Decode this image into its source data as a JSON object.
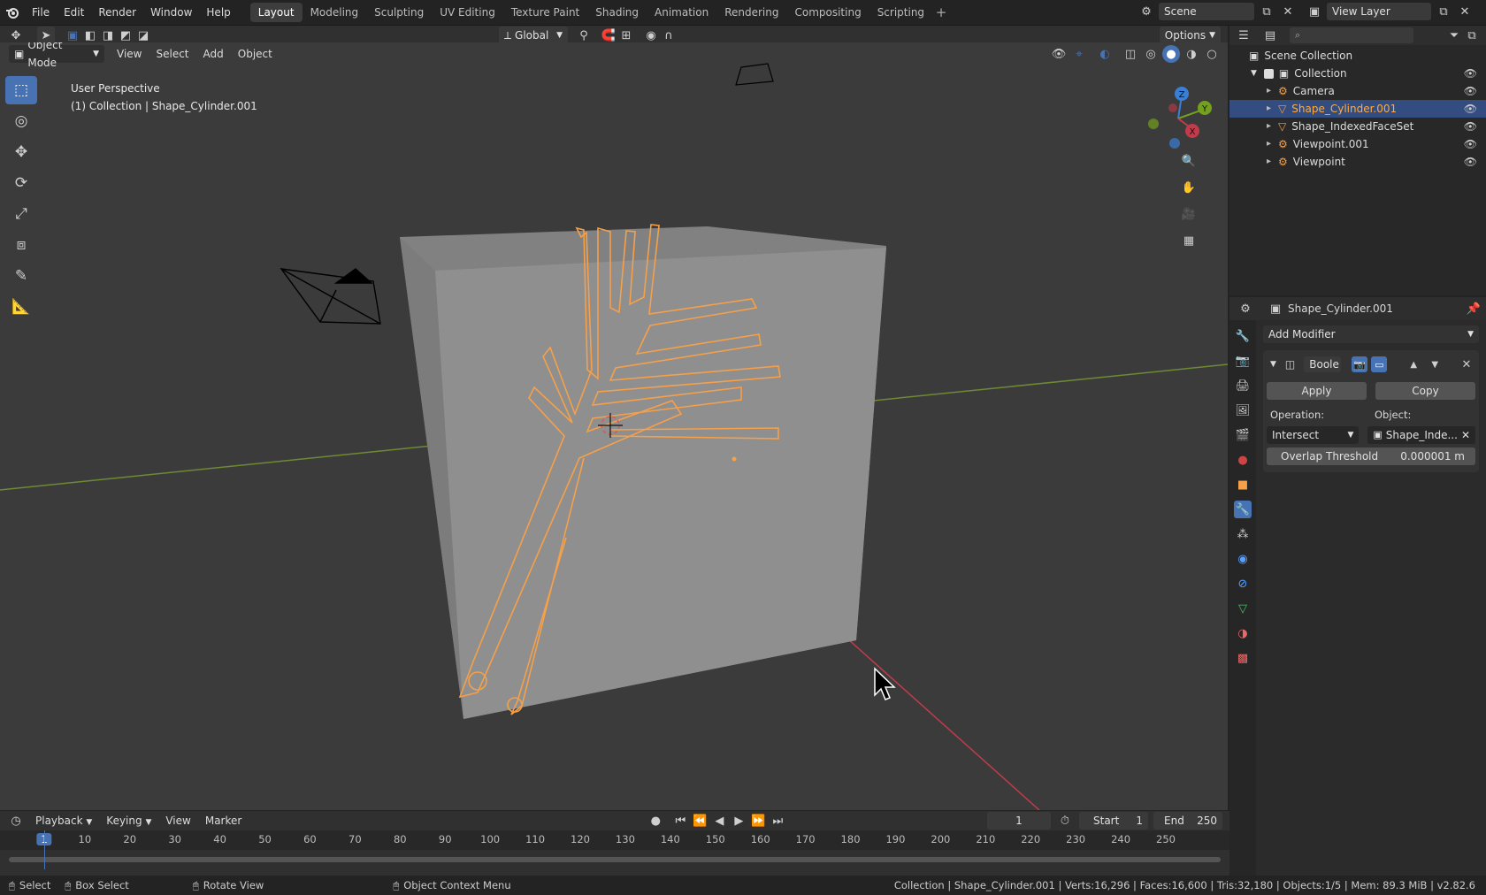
{
  "menus": [
    "File",
    "Edit",
    "Render",
    "Window",
    "Help"
  ],
  "workspaces": [
    "Layout",
    "Modeling",
    "Sculpting",
    "UV Editing",
    "Texture Paint",
    "Shading",
    "Animation",
    "Rendering",
    "Compositing",
    "Scripting"
  ],
  "active_workspace": "Layout",
  "scene": "Scene",
  "view_layer": "View Layer",
  "header": {
    "orientation": "Global",
    "options": "Options",
    "mode": "Object Mode",
    "view": "View",
    "select": "Select",
    "add": "Add",
    "object": "Object"
  },
  "viewport": {
    "perspective": "User Perspective",
    "collection_info": "(1) Collection | Shape_Cylinder.001",
    "gizmo": {
      "z": "Z",
      "y": "Y",
      "x": "X"
    }
  },
  "outliner": {
    "root": "Scene Collection",
    "collection": "Collection",
    "items": [
      {
        "label": "Camera",
        "selected": false
      },
      {
        "label": "Shape_Cylinder.001",
        "selected": true
      },
      {
        "label": "Shape_IndexedFaceSet",
        "selected": false
      },
      {
        "label": "Viewpoint.001",
        "selected": false
      },
      {
        "label": "Viewpoint",
        "selected": false
      }
    ]
  },
  "properties": {
    "object_name": "Shape_Cylinder.001",
    "add_modifier": "Add Modifier",
    "modifier_name": "Boole",
    "apply": "Apply",
    "copy": "Copy",
    "operation_label": "Operation:",
    "object_label": "Object:",
    "operation_value": "Intersect",
    "object_value": "Shape_Inde...",
    "overlap_label": "Overlap Threshold",
    "overlap_value": "0.000001 m"
  },
  "timeline": {
    "playback": "Playback",
    "keying": "Keying",
    "view": "View",
    "marker": "Marker",
    "current_frame": "1",
    "start_label": "Start",
    "start_value": "1",
    "end_label": "End",
    "end_value": "250",
    "ruler": [
      "1",
      "10",
      "20",
      "30",
      "40",
      "50",
      "60",
      "70",
      "80",
      "90",
      "100",
      "110",
      "120",
      "130",
      "140",
      "150",
      "160",
      "170",
      "180",
      "190",
      "200",
      "210",
      "220",
      "230",
      "240",
      "250"
    ]
  },
  "status": {
    "select": "Select",
    "box_select": "Box Select",
    "rotate_view": "Rotate View",
    "context_menu": "Object Context Menu",
    "stats": "Collection | Shape_Cylinder.001 | Verts:16,296 | Faces:16,600 | Tris:32,180 | Objects:1/5 | Mem: 89.3 MiB | v2.82.6"
  },
  "colors": {
    "accent": "#4772b3",
    "selected_orange": "#ffab40",
    "x_axis": "#c23b4b",
    "y_axis": "#74a01f",
    "z_axis": "#3a7fd4"
  }
}
